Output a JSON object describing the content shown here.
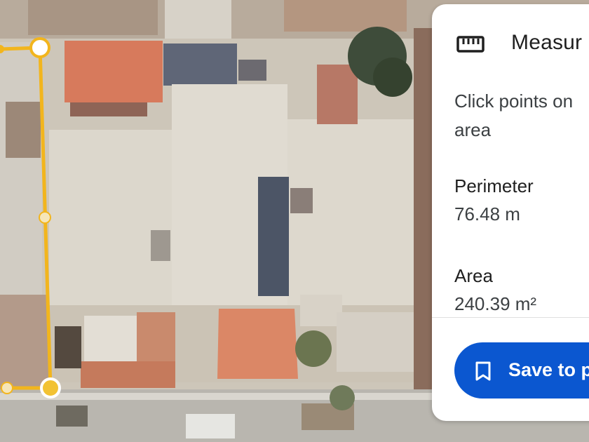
{
  "map": {
    "measure_color": "#f2b51d"
  },
  "panel": {
    "title": "Measur",
    "icon": "ruler-icon",
    "instructions_line1": "Click points on",
    "instructions_line2": "area",
    "perimeter_label": "Perimeter",
    "perimeter_value": "76.48 m",
    "area_label": "Area",
    "area_value": "240.39 m²",
    "save_label": "Save to p",
    "save_icon": "bookmark-icon",
    "accent": "#0b57d0"
  }
}
